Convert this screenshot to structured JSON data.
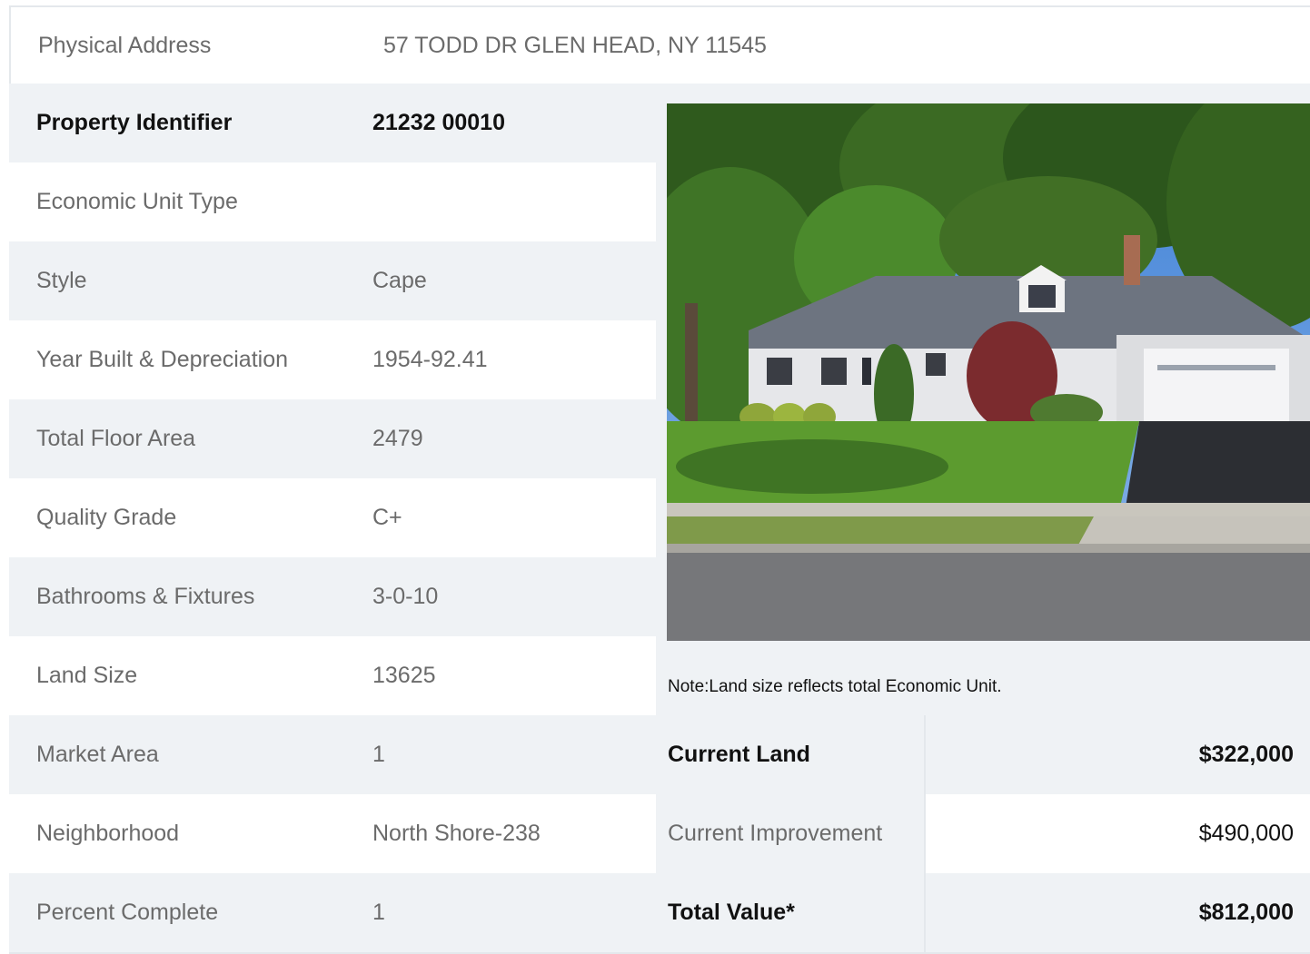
{
  "address": {
    "label": "Physical Address",
    "value": "57  TODD DR  GLEN HEAD, NY  11545"
  },
  "rows": [
    {
      "label": "Property Identifier",
      "value": "21232  00010"
    },
    {
      "label": "Economic Unit Type",
      "value": ""
    },
    {
      "label": "Style",
      "value": "Cape"
    },
    {
      "label": "Year Built & Depreciation",
      "value": "1954-92.41"
    },
    {
      "label": "Total Floor Area",
      "value": "2479"
    },
    {
      "label": "Quality Grade",
      "value": "C+"
    },
    {
      "label": "Bathrooms & Fixtures",
      "value": "3-0-10"
    },
    {
      "label": "Land Size",
      "value": "13625"
    },
    {
      "label": "Market Area",
      "value": "1"
    },
    {
      "label": "Neighborhood",
      "value": "North Shore-238"
    },
    {
      "label": "Percent Complete",
      "value": "1"
    }
  ],
  "note": "Note:Land size reflects total Economic Unit.",
  "values": [
    {
      "label": "Current Land",
      "value": "$322,000"
    },
    {
      "label": "Current Improvement",
      "value": "$490,000"
    },
    {
      "label": "Total Value*",
      "value": "$812,000"
    }
  ],
  "photo": {
    "subject": "house-photo"
  }
}
